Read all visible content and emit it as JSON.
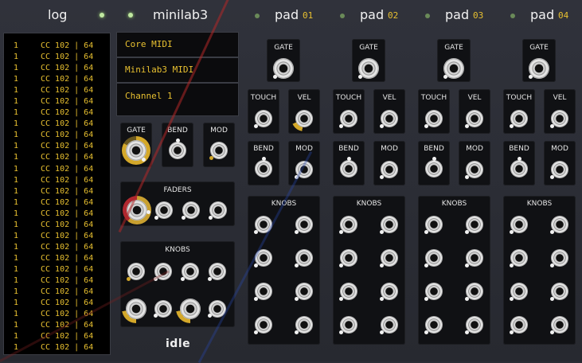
{
  "header": {
    "log_title": "log",
    "device_title": "minilab3",
    "pads": [
      {
        "label": "pad",
        "number": "01"
      },
      {
        "label": "pad",
        "number": "02"
      },
      {
        "label": "pad",
        "number": "03"
      },
      {
        "label": "pad",
        "number": "04"
      }
    ]
  },
  "log": {
    "rows": [
      {
        "ch": "1",
        "msg": "CC 102 | 64"
      },
      {
        "ch": "1",
        "msg": "CC 102 | 64"
      },
      {
        "ch": "1",
        "msg": "CC 102 | 64"
      },
      {
        "ch": "1",
        "msg": "CC 102 | 64"
      },
      {
        "ch": "1",
        "msg": "CC 102 | 64"
      },
      {
        "ch": "1",
        "msg": "CC 102 | 64"
      },
      {
        "ch": "1",
        "msg": "CC 102 | 64"
      },
      {
        "ch": "1",
        "msg": "CC 102 | 64"
      },
      {
        "ch": "1",
        "msg": "CC 102 | 64"
      },
      {
        "ch": "1",
        "msg": "CC 102 | 64"
      },
      {
        "ch": "1",
        "msg": "CC 102 | 64"
      },
      {
        "ch": "1",
        "msg": "CC 102 | 64"
      },
      {
        "ch": "1",
        "msg": "CC 102 | 64"
      },
      {
        "ch": "1",
        "msg": "CC 102 | 64"
      },
      {
        "ch": "1",
        "msg": "CC 102 | 64"
      },
      {
        "ch": "1",
        "msg": "CC 102 | 64"
      },
      {
        "ch": "1",
        "msg": "CC 102 | 64"
      },
      {
        "ch": "1",
        "msg": "CC 102 | 64"
      },
      {
        "ch": "1",
        "msg": "CC 102 | 64"
      },
      {
        "ch": "1",
        "msg": "CC 102 | 64"
      },
      {
        "ch": "1",
        "msg": "CC 102 | 64"
      },
      {
        "ch": "1",
        "msg": "CC 102 | 64"
      },
      {
        "ch": "1",
        "msg": "CC 102 | 64"
      },
      {
        "ch": "1",
        "msg": "CC 102 | 64"
      },
      {
        "ch": "1",
        "msg": "CC 102 | 64"
      },
      {
        "ch": "1",
        "msg": "CC 102 | 64"
      },
      {
        "ch": "1",
        "msg": "CC 102 | 64"
      },
      {
        "ch": "1",
        "msg": "CC 102 | 64"
      }
    ]
  },
  "menus": {
    "driver": "Core MIDI",
    "device": "Minilab3 MIDI",
    "channel": "Channel 1"
  },
  "controls": {
    "gate": "GATE",
    "bend": "BEND",
    "mod": "MOD",
    "faders": "FADERS",
    "knobs": "KNOBS"
  },
  "pad_controls": {
    "gate": "GATE",
    "touch": "TOUCH",
    "vel": "VEL",
    "bend": "BEND",
    "mod": "MOD",
    "knobs": "KNOBS"
  },
  "logo": "idle",
  "colors": {
    "accent": "#e8c030",
    "cable": "#c0302c",
    "cable2": "#3050c0",
    "led": "#bfe8a0"
  }
}
